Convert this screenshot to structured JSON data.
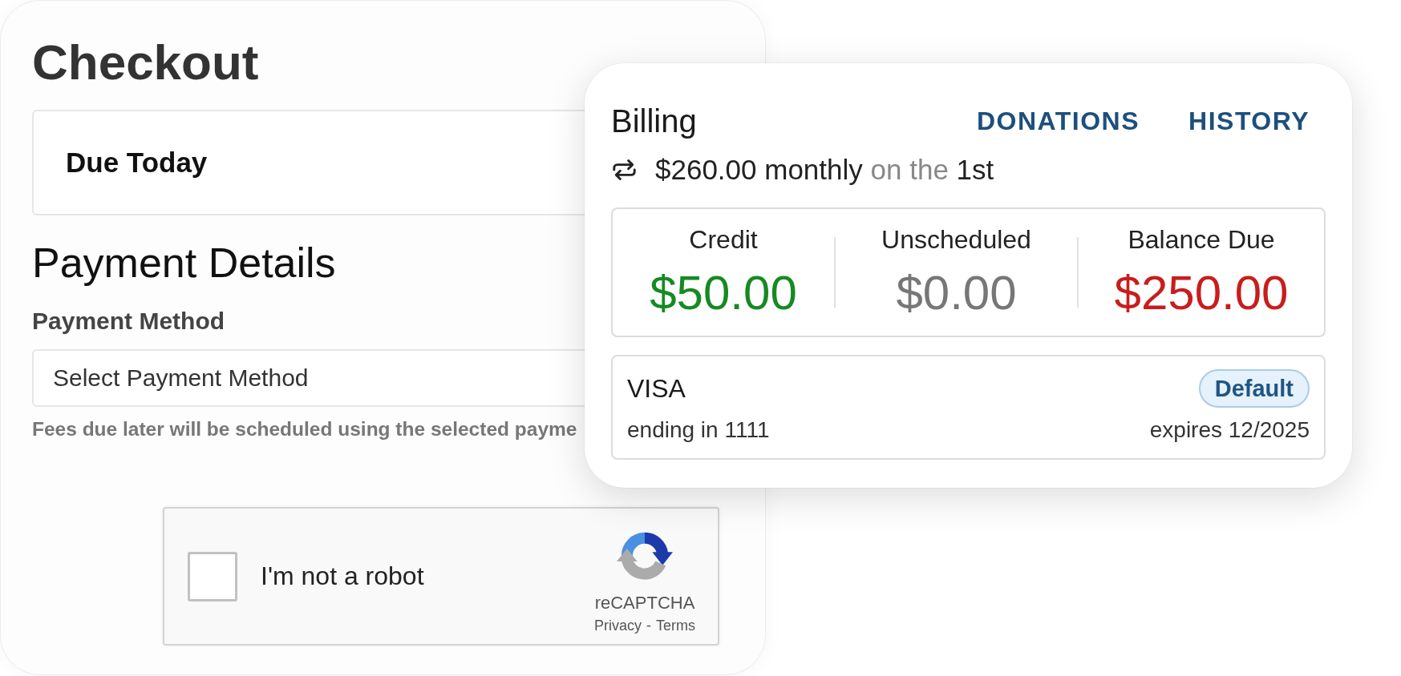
{
  "checkout": {
    "title": "Checkout",
    "due_today": {
      "label": "Due Today"
    },
    "payment_details": {
      "heading": "Payment Details",
      "method_label": "Payment Method",
      "method_value": "Select Payment Method",
      "help_text": "Fees due later will be scheduled using the selected payme"
    },
    "captcha": {
      "checked": false,
      "label": "I'm not a robot",
      "brand": "reCAPTCHA",
      "privacy_link": "Privacy",
      "separator": "-",
      "terms_link": "Terms"
    }
  },
  "billing": {
    "title": "Billing",
    "links": [
      "DONATIONS",
      "HISTORY"
    ],
    "schedule": {
      "amount": "$260.00 monthly",
      "connector": "on the",
      "day": "1st"
    },
    "summary": [
      {
        "label": "Credit",
        "value": "$50.00",
        "color": "#168a22"
      },
      {
        "label": "Unscheduled",
        "value": "$0.00",
        "color": "#777777"
      },
      {
        "label": "Balance Due",
        "value": "$250.00",
        "color": "#c91d1d"
      }
    ],
    "payment_card": {
      "brand": "VISA",
      "badge": "Default",
      "ending": "ending in 1111",
      "expires": "expires 12/2025"
    }
  }
}
